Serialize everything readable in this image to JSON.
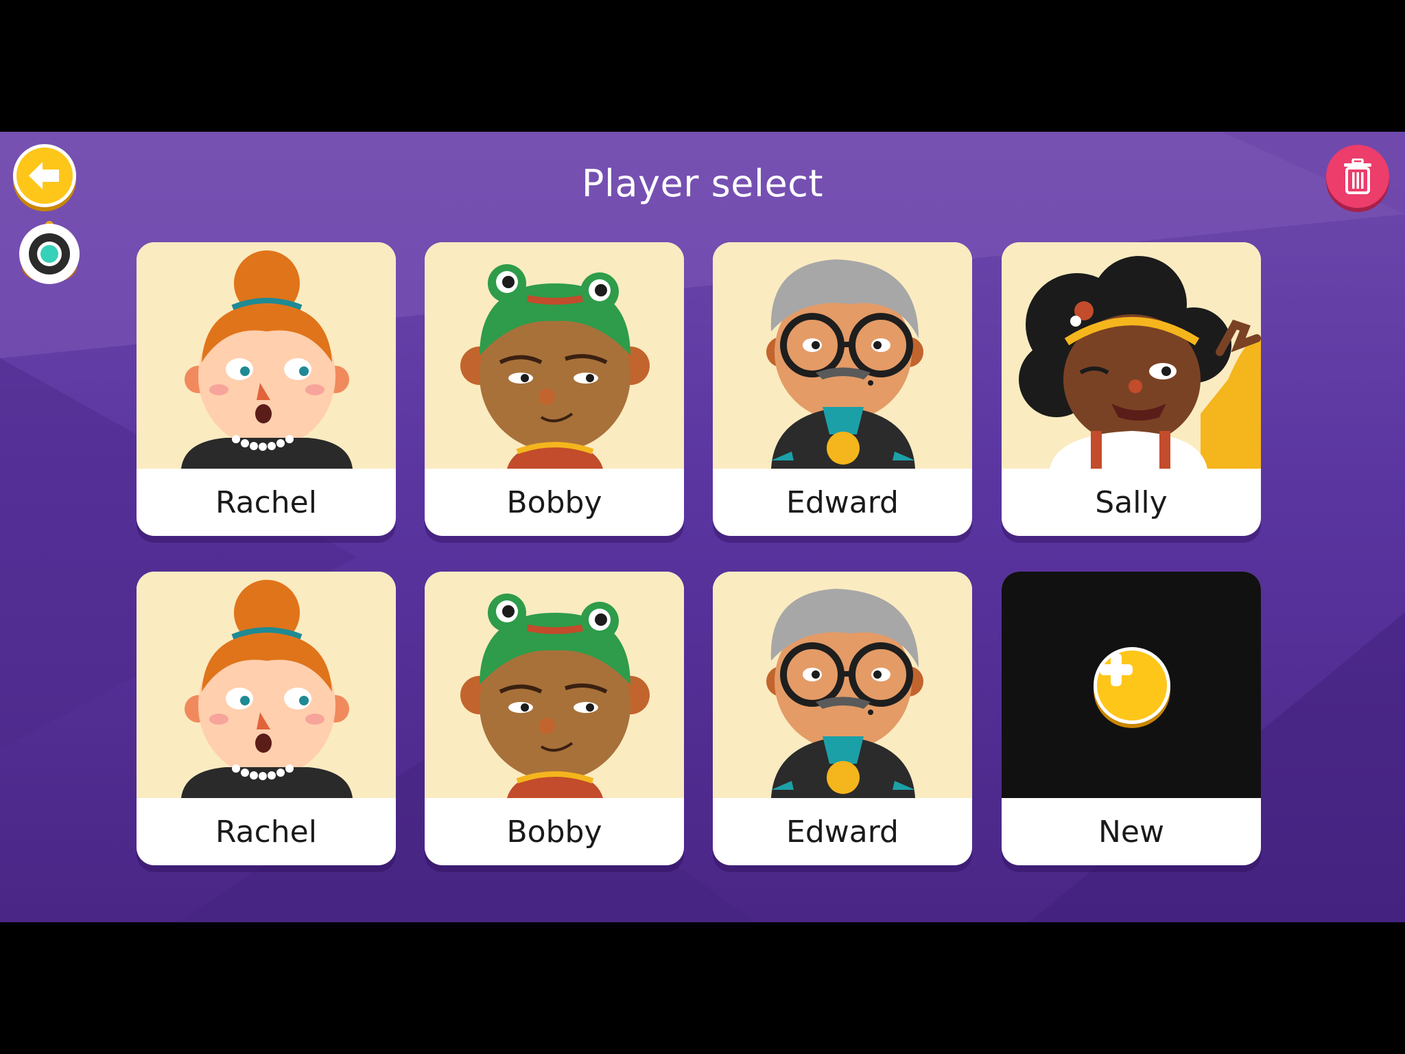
{
  "title": "Player select",
  "header": {
    "back_icon": "arrow-left-icon",
    "delete_icon": "trash-icon",
    "avatar_icon": "robot-icon"
  },
  "players": [
    {
      "name": "Rachel",
      "avatar": "rachel"
    },
    {
      "name": "Bobby",
      "avatar": "bobby"
    },
    {
      "name": "Edward",
      "avatar": "edward"
    },
    {
      "name": "Sally",
      "avatar": "sally"
    },
    {
      "name": "Rachel",
      "avatar": "rachel"
    },
    {
      "name": "Bobby",
      "avatar": "bobby"
    },
    {
      "name": "Edward",
      "avatar": "edward"
    }
  ],
  "new_player": {
    "label": "New",
    "icon": "plus-icon"
  },
  "colors": {
    "background": "#5a35a0",
    "portrait_bg": "#fbebc1",
    "back_button": "#ffc61a",
    "delete_button": "#ec3d6b",
    "new_tile": "#111112"
  }
}
